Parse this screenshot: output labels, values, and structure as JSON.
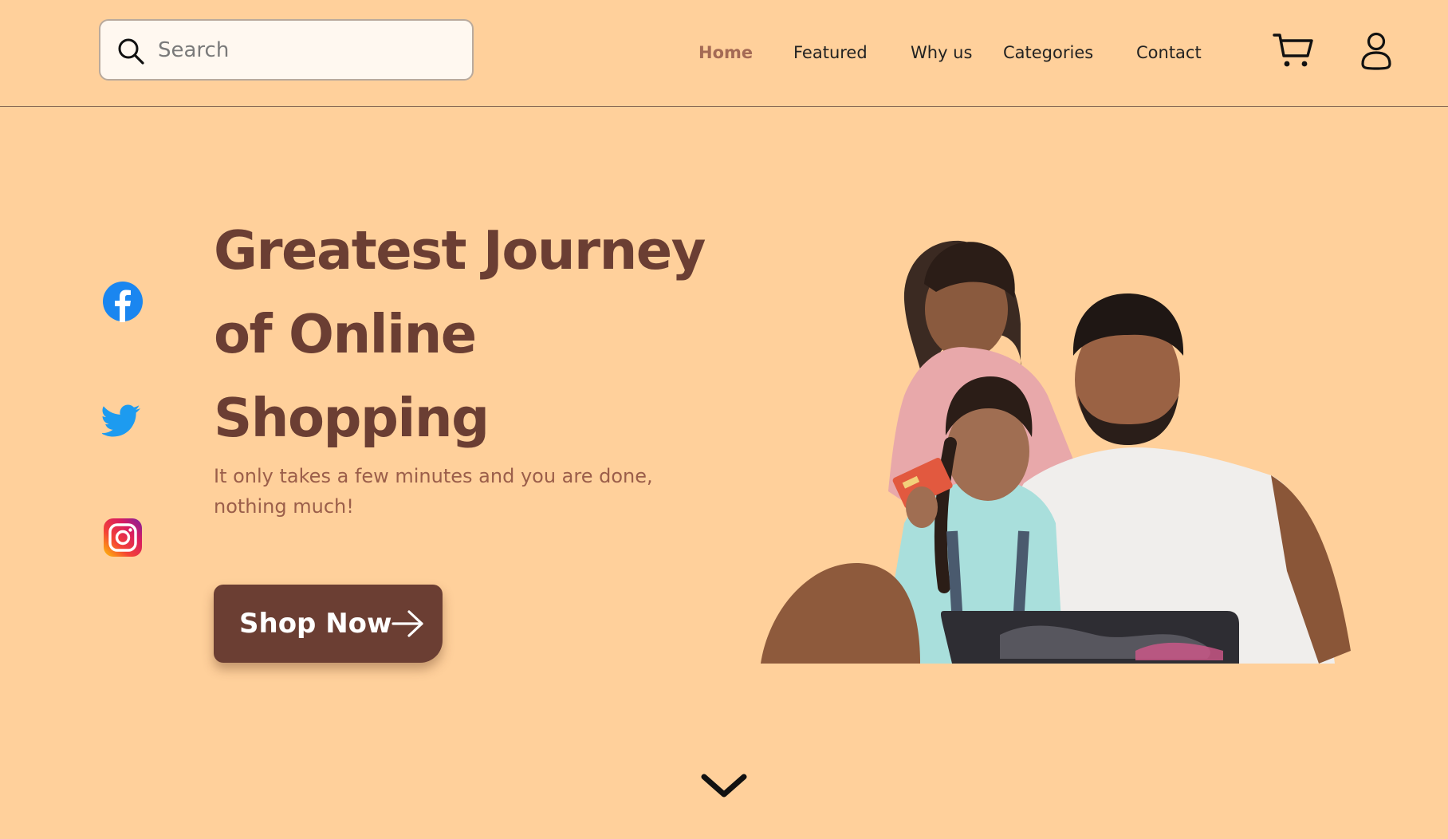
{
  "header": {
    "search": {
      "placeholder": "Search",
      "value": ""
    },
    "nav": [
      {
        "label": "Home",
        "active": true
      },
      {
        "label": "Featured",
        "active": false
      },
      {
        "label": "Why us",
        "active": false
      },
      {
        "label": "Categories",
        "active": false
      },
      {
        "label": "Contact",
        "active": false
      }
    ],
    "icons": [
      "cart-icon",
      "user-icon"
    ]
  },
  "social": [
    "facebook-icon",
    "twitter-icon",
    "instagram-icon"
  ],
  "hero": {
    "title_lines": [
      "Greatest Journey",
      "of Online",
      "Shopping"
    ],
    "subtitle": "It only takes a few minutes and you are done, nothing much!",
    "cta_label": "Shop Now"
  },
  "colors": {
    "background": "#FFD09B",
    "primary": "#6B3E33",
    "accent": "#A46A55",
    "subtitle": "#9B5E4A"
  }
}
